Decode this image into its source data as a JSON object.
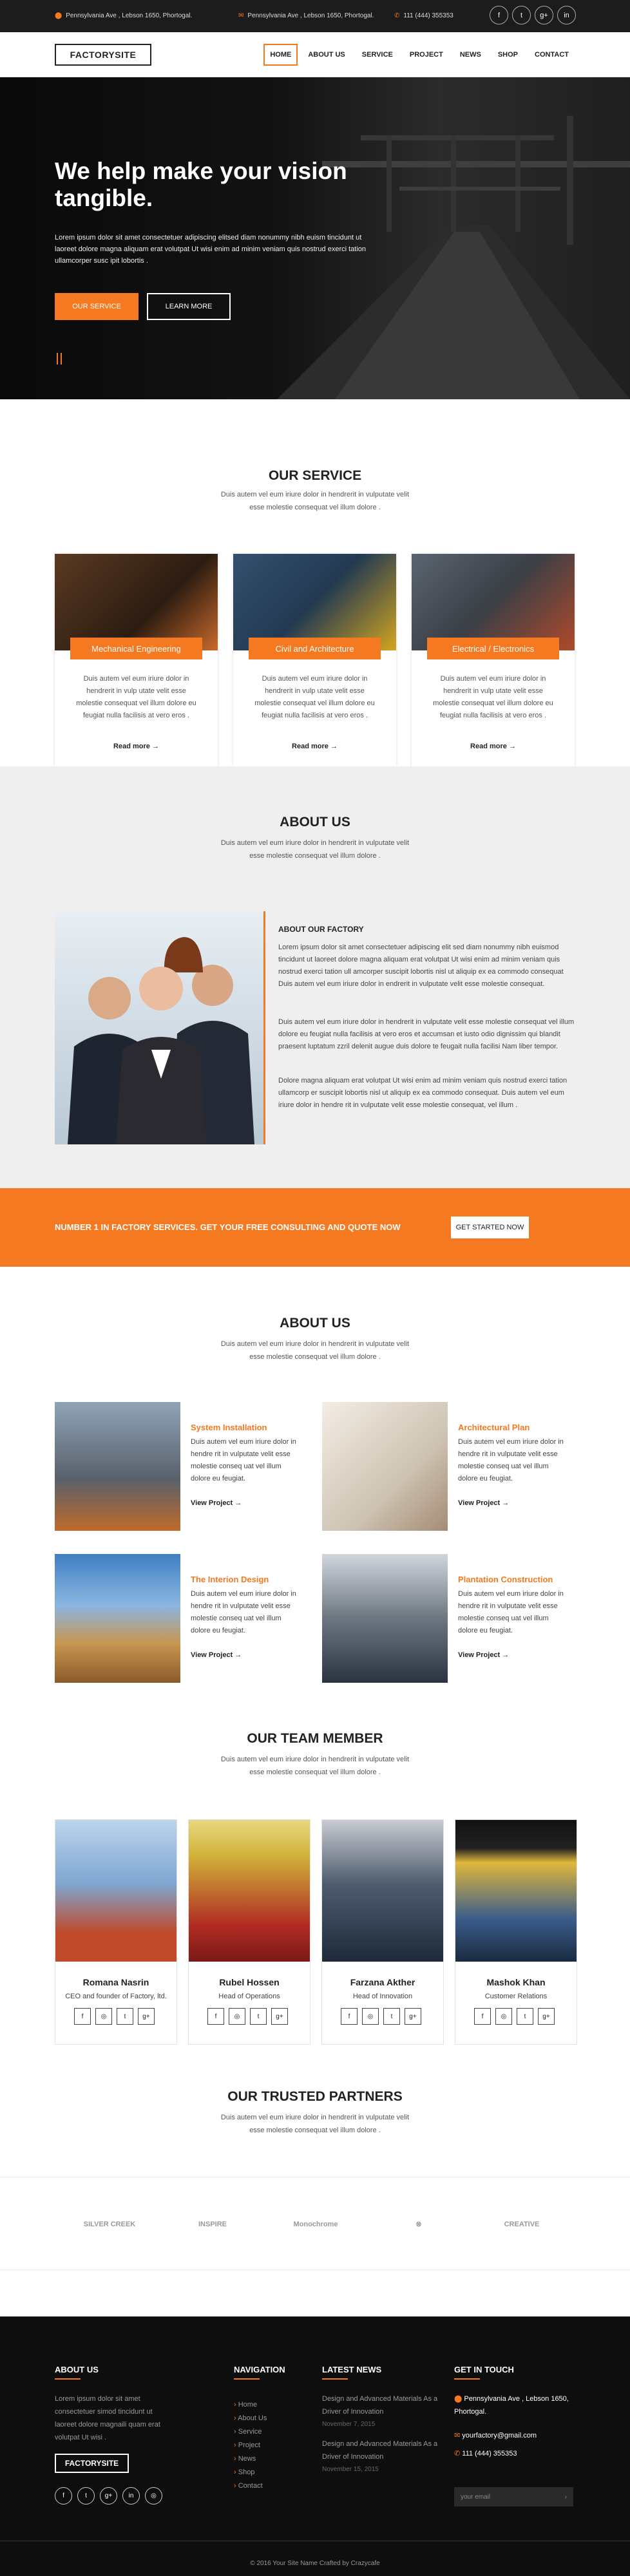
{
  "topbar": {
    "address1": "Pennsylvania Ave , Lebson 1650, Phortogal.",
    "address2": "Pennsylvania Ave , Lebson 1650, Phortogal.",
    "phone": "111 (444) 355353",
    "social": [
      "f",
      "t",
      "g+",
      "in"
    ]
  },
  "nav": {
    "logo": "FACTORYSITE",
    "items": [
      "HOME",
      "ABOUT US",
      "SERVICE",
      "PROJECT",
      "NEWS",
      "SHOP",
      "CONTACT"
    ]
  },
  "hero": {
    "title": "We help make your vision tangible.",
    "text": "Lorem ipsum dolor sit amet consectetuer adipiscing elitsed diam nonummy nibh euism tincidunt ut laoreet dolore magna aliquam erat volutpat Ut wisi enim ad minim veniam quis nostrud exerci tation ullamcorper susc ipit lobortis .",
    "btn1": "OUR SERVICE",
    "btn2": "LEARN MORE"
  },
  "service": {
    "title": "OUR SERVICE",
    "sub": "Duis autem vel eum iriure dolor in hendrerit in vulputate velit esse molestie consequat vel illum dolore .",
    "cards": [
      {
        "tag": "Mechanical Engineering",
        "text": "Duis autem vel eum iriure dolor in hendrerit in vulp utate velit esse molestie consequat vel illum dolore eu feugiat nulla facilisis at vero eros .",
        "more": "Read more →"
      },
      {
        "tag": "Civil and Architecture",
        "text": "Duis autem vel eum iriure dolor in hendrerit in vulp utate velit esse molestie consequat vel illum dolore eu feugiat nulla facilisis at vero eros .",
        "more": "Read more →"
      },
      {
        "tag": "Electrical / Electronics",
        "text": "Duis autem vel eum iriure dolor in hendrerit in vulp utate velit esse molestie consequat vel illum dolore eu feugiat nulla facilisis at vero eros .",
        "more": "Read more →"
      }
    ]
  },
  "about": {
    "title": "ABOUT US",
    "sub": "Duis autem vel eum iriure dolor in hendrerit in vulputate velit esse molestie consequat vel illum dolore .",
    "heading": "ABOUT OUR FACTORY",
    "p1": "Lorem ipsum dolor sit amet consectetuer adipiscing elit sed diam nonummy nibh euismod tincidunt ut laoreet dolore magna aliquam erat volutpat Ut wisi enim ad minim veniam quis nostrud exerci tation ull amcorper suscipit lobortis nisl ut aliquip ex ea commodo consequat Duis autem vel eum iriure dolor in endrerit in vulputate velit esse molestie consequat.",
    "p2": "Duis autem vel eum iriure dolor in hendrerit in vulputate velit esse molestie consequat vel illum dolore eu feugiat nulla facilisis at vero eros et accumsan et iusto odio dignissim qui blandit praesent luptatum zzril delenit augue duis dolore te feugait nulla facilisi Nam liber tempor.",
    "p3": "Dolore magna aliquam erat volutpat Ut wisi enim ad minim veniam quis nostrud exerci tation ullamcorp er suscipit lobortis nisl ut aliquip ex ea commodo consequat. Duis autem vel eum iriure dolor in hendre rit in vulputate velit esse molestie consequat, vel illum ."
  },
  "cta": {
    "text": "NUMBER 1 IN FACTORY SERVICES. GET YOUR FREE CONSULTING AND QUOTE NOW",
    "button": "GET STARTED NOW"
  },
  "projects": {
    "title": "ABOUT US",
    "sub": "Duis autem vel eum iriure dolor in hendrerit in vulputate velit esse molestie consequat vel illum dolore .",
    "items": [
      {
        "title": "System Installation",
        "text": "Duis autem vel eum iriure dolor in hendre rit in vulputate velit esse molestie conseq uat vel illum dolore eu feugiat.",
        "link": "View Project →"
      },
      {
        "title": "Architectural Plan",
        "text": "Duis autem vel eum iriure dolor in hendre rit in vulputate velit esse molestie conseq uat vel illum dolore eu feugiat.",
        "link": "View Project →"
      },
      {
        "title": "The Interion Design",
        "text": "Duis autem vel eum iriure dolor in hendre rit in vulputate velit esse molestie conseq uat vel illum dolore eu feugiat.",
        "link": "View Project →"
      },
      {
        "title": "Plantation Construction",
        "text": "Duis autem vel eum iriure dolor in hendre rit in vulputate velit esse molestie conseq uat vel illum dolore eu feugiat.",
        "link": "View Project →"
      }
    ]
  },
  "team": {
    "title": "OUR TEAM MEMBER",
    "sub": "Duis autem vel eum iriure dolor in hendrerit in vulputate velit esse molestie consequat vel illum dolore .",
    "members": [
      {
        "name": "Romana Nasrin",
        "role": "CEO and founder of Factory, ltd."
      },
      {
        "name": "Rubel Hossen",
        "role": "Head of Operations"
      },
      {
        "name": "Farzana Akther",
        "role": "Head of Innovation"
      },
      {
        "name": "Mashok Khan",
        "role": "Customer Relations"
      }
    ],
    "social": [
      "f",
      "◎",
      "t",
      "g+"
    ]
  },
  "partners": {
    "title": "OUR TRUSTED PARTNERS",
    "sub": "Duis autem vel eum iriure dolor in hendrerit in vulputate velit esse molestie consequat vel illum dolore .",
    "logos": [
      "SILVER CREEK",
      "INSPIRE",
      "Monochrome",
      "⊗",
      "CREATIVE"
    ]
  },
  "footer": {
    "about_title": "ABOUT US",
    "about_text": "Lorem ipsum dolor sit amet consectetuer simod tincidunt ut laoreet dolore magnaili quam erat volutpat Ut wisi .",
    "logo": "FACTORYSITE",
    "social": [
      "f",
      "t",
      "g+",
      "in",
      "◎"
    ],
    "nav_title": "NAVIGATION",
    "nav": [
      "Home",
      "About Us",
      "Service",
      "Project",
      "News",
      "Shop",
      "Contact"
    ],
    "news_title": "LATEST NEWS",
    "news": [
      {
        "title": "Design and Advanced Materials As a Driver of Innovation",
        "date": "November 7, 2015"
      },
      {
        "title": "Design and Advanced Materials As a Driver of Innovation",
        "date": "November 15, 2015"
      }
    ],
    "contact_title": "GET IN TOUCH",
    "address": "Pennsylvania Ave , Lebson 1650, Phortogal.",
    "email": "yourfactory@gmail.com",
    "phone": "111 (444) 355353",
    "email_placeholder": "your email",
    "copyright": "© 2016 Your Site Name Crafted by Crazycafe"
  },
  "colors": {
    "accent": "#f47920",
    "dark": "#0e0e0e"
  }
}
